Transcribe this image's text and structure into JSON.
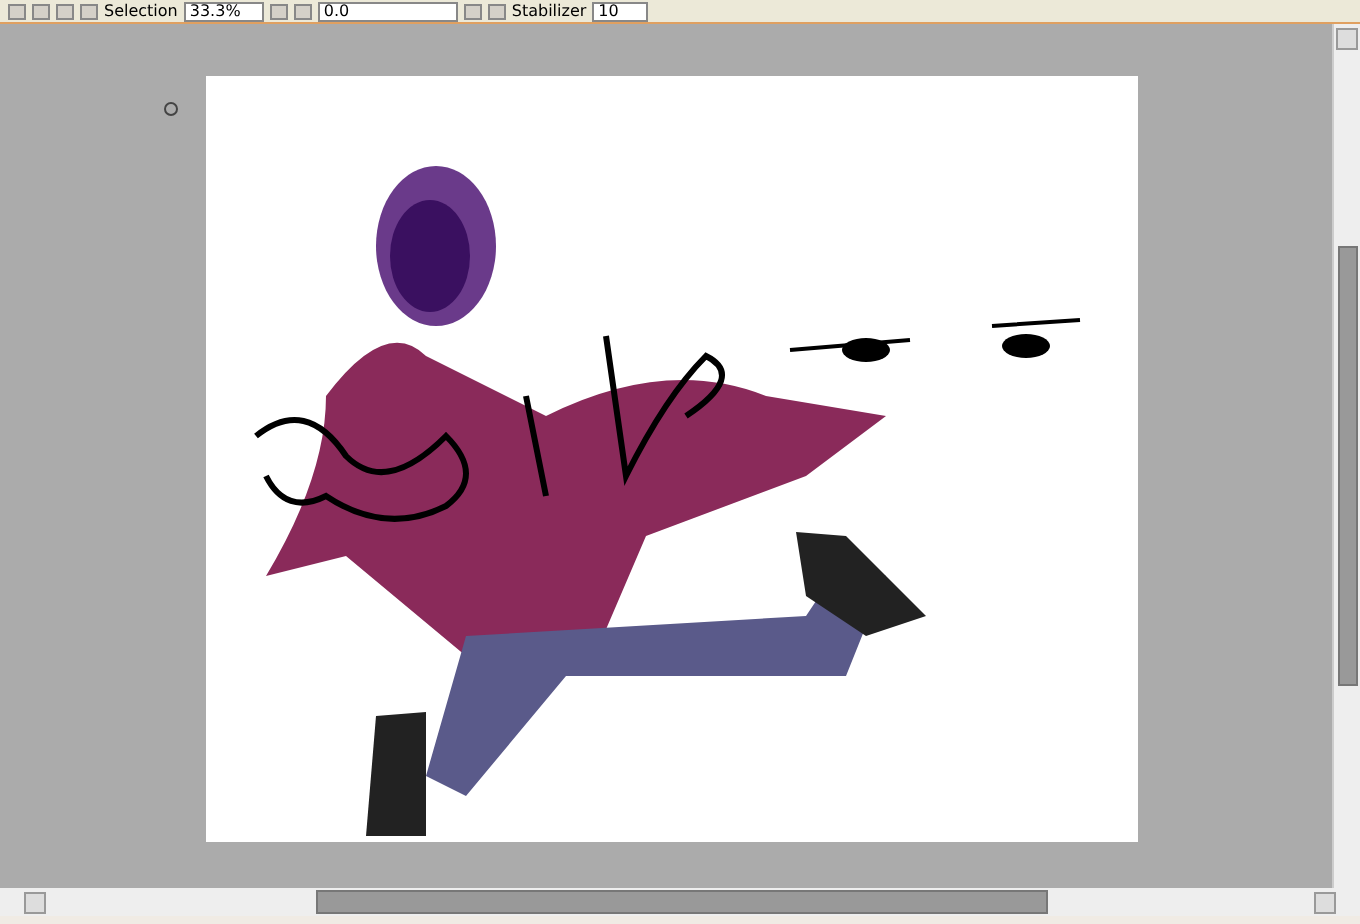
{
  "toolbar": {
    "selection_label": "Selection",
    "zoom": "33.3%",
    "rotation": "0.0",
    "stabilizer_label": "Stabilizer",
    "stabilizer_value": "10"
  }
}
